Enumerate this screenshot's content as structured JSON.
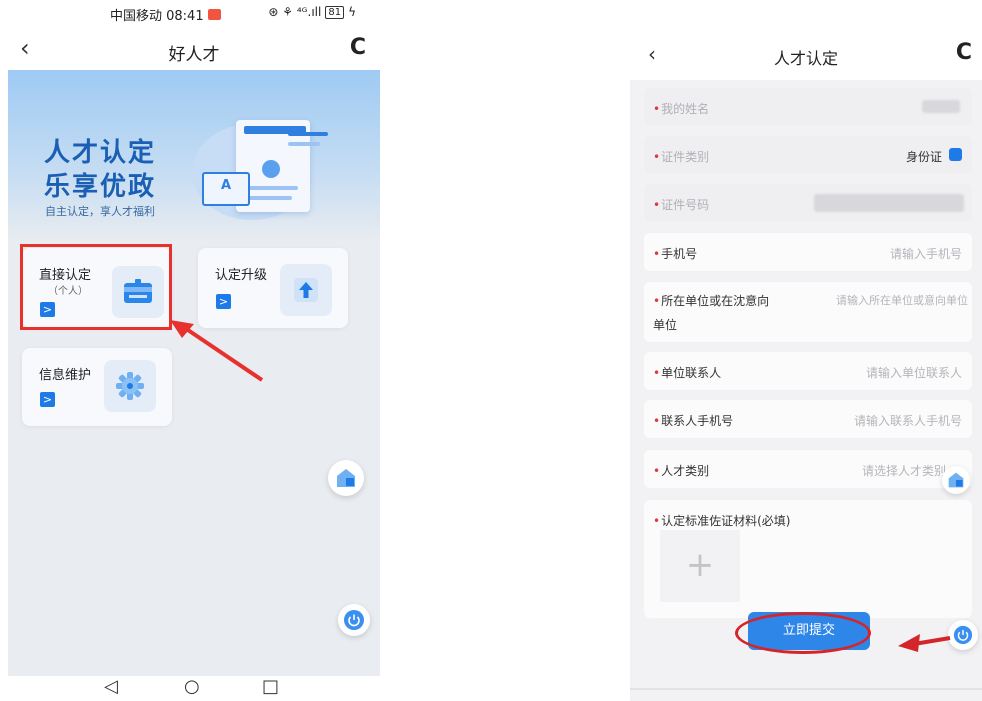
{
  "left": {
    "status": {
      "carrier_time": "中国移动 08:41",
      "signal": "⊛ ⚘ ⁴ᴳ.ıll",
      "battery": "81"
    },
    "nav": {
      "back": "‹",
      "title": "好人才",
      "refresh": "C"
    },
    "banner": {
      "title_line1": "人才认定",
      "title_line2": "乐享优政",
      "subtitle": "自主认定，享人才福利",
      "card_letter": "A"
    },
    "tiles": [
      {
        "label": "直接认定",
        "sub": "（个人）",
        "arrow": ">"
      },
      {
        "label": "认定升级",
        "arrow": ">"
      },
      {
        "label": "信息维护",
        "arrow": ">"
      }
    ],
    "sysnav": {
      "back": "◁",
      "home": "○",
      "recent": "□"
    }
  },
  "right": {
    "nav": {
      "back": "‹",
      "title": "人才认定",
      "refresh": "C"
    },
    "fields": [
      {
        "label": "我的姓名",
        "dim": true
      },
      {
        "label": "证件类别",
        "value": "身份证",
        "dim": true
      },
      {
        "label": "证件号码",
        "dim": true
      },
      {
        "label": "手机号",
        "placeholder": "请输入手机号"
      },
      {
        "label": "所在单位或在沈意向",
        "label2": "单位",
        "placeholder": "请输入所在单位或意向单位"
      },
      {
        "label": "单位联系人",
        "placeholder": "请输入单位联系人"
      },
      {
        "label": "联系人手机号",
        "placeholder": "请输入联系人手机号"
      },
      {
        "label": "人才类别",
        "placeholder": "请选择人才类别"
      },
      {
        "label": "认定标准佐证材料(必填)"
      }
    ],
    "upload_plus": "+",
    "submit": "立即提交"
  },
  "colors": {
    "accent": "#1e7ae6",
    "annotation_red": "#e8302e",
    "brand_dark_blue": "#1a5fb4"
  }
}
